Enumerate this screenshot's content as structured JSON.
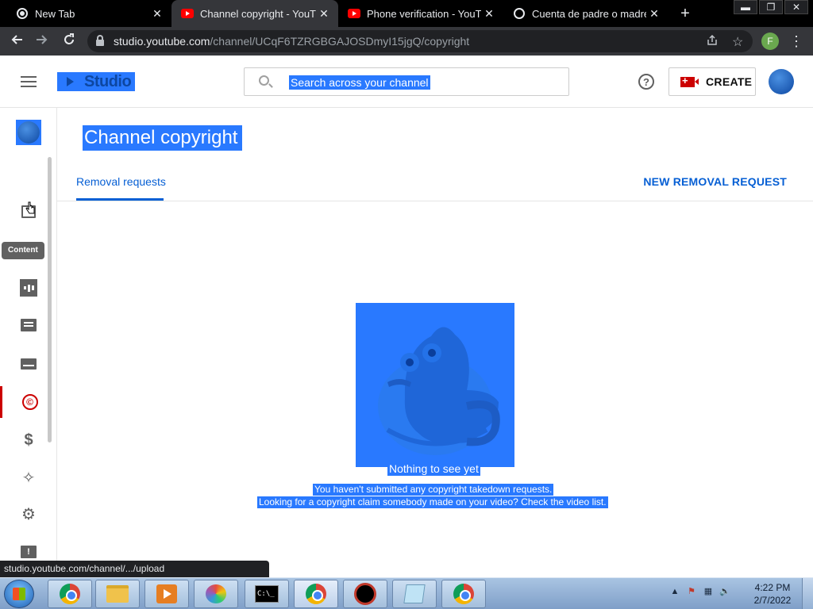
{
  "browser": {
    "tabs": [
      {
        "title": "New Tab",
        "icon": "chrome-icon",
        "active": false
      },
      {
        "title": "Channel copyright - YouTube",
        "icon": "youtube-icon",
        "active": true
      },
      {
        "title": "Phone verification - YouTube",
        "icon": "youtube-icon",
        "active": false
      },
      {
        "title": "Cuenta de padre o madre",
        "icon": "globe-icon",
        "active": false
      }
    ],
    "new_tab_symbol": "+",
    "window_controls": {
      "minimize": "▬",
      "restore": "❐",
      "close": "✕"
    },
    "url_host": "studio.youtube.com",
    "url_path": "/channel/UCqF6TZRGBGAJOSDmyI15jgQ/copyright",
    "profile_initial": "F"
  },
  "studio": {
    "logo_text": "Studio",
    "search_placeholder": "Search across your channel",
    "help_symbol": "?",
    "create_label": "CREATE"
  },
  "sidebar": {
    "items": [
      {
        "name": "dashboard",
        "icon": "dashboard-icon"
      },
      {
        "name": "content",
        "icon": "content-icon"
      },
      {
        "name": "analytics",
        "icon": "analytics-icon"
      },
      {
        "name": "comments",
        "icon": "comments-icon"
      },
      {
        "name": "subtitles",
        "icon": "subtitles-icon"
      },
      {
        "name": "copyright",
        "icon": "copyright-icon",
        "active": true
      },
      {
        "name": "earn",
        "icon": "dollar-icon"
      },
      {
        "name": "customization",
        "icon": "magic-wand-icon"
      },
      {
        "name": "settings",
        "icon": "gear-icon"
      },
      {
        "name": "feedback",
        "icon": "feedback-icon"
      }
    ],
    "tooltip": "Content",
    "copyright_symbol": "©",
    "dollar_symbol": "$",
    "feedback_symbol": "!"
  },
  "main": {
    "title": "Channel copyright",
    "tab_label": "Removal requests",
    "new_request_label": "NEW REMOVAL REQUEST",
    "empty_state": {
      "title": "Nothing to see yet",
      "line1": "You haven't submitted any copyright takedown requests.",
      "line2": "Looking for a copyright claim somebody made on your video? Check the video list."
    }
  },
  "status_bar": {
    "url": "studio.youtube.com/channel/.../upload"
  },
  "taskbar": {
    "cmd_text": "C:\\_",
    "time": "4:22 PM",
    "date": "2/7/2022"
  },
  "colors": {
    "accent": "#065fd4",
    "selection": "#2979ff",
    "youtube_red": "#ff0000",
    "studio_red": "#cc0000"
  }
}
